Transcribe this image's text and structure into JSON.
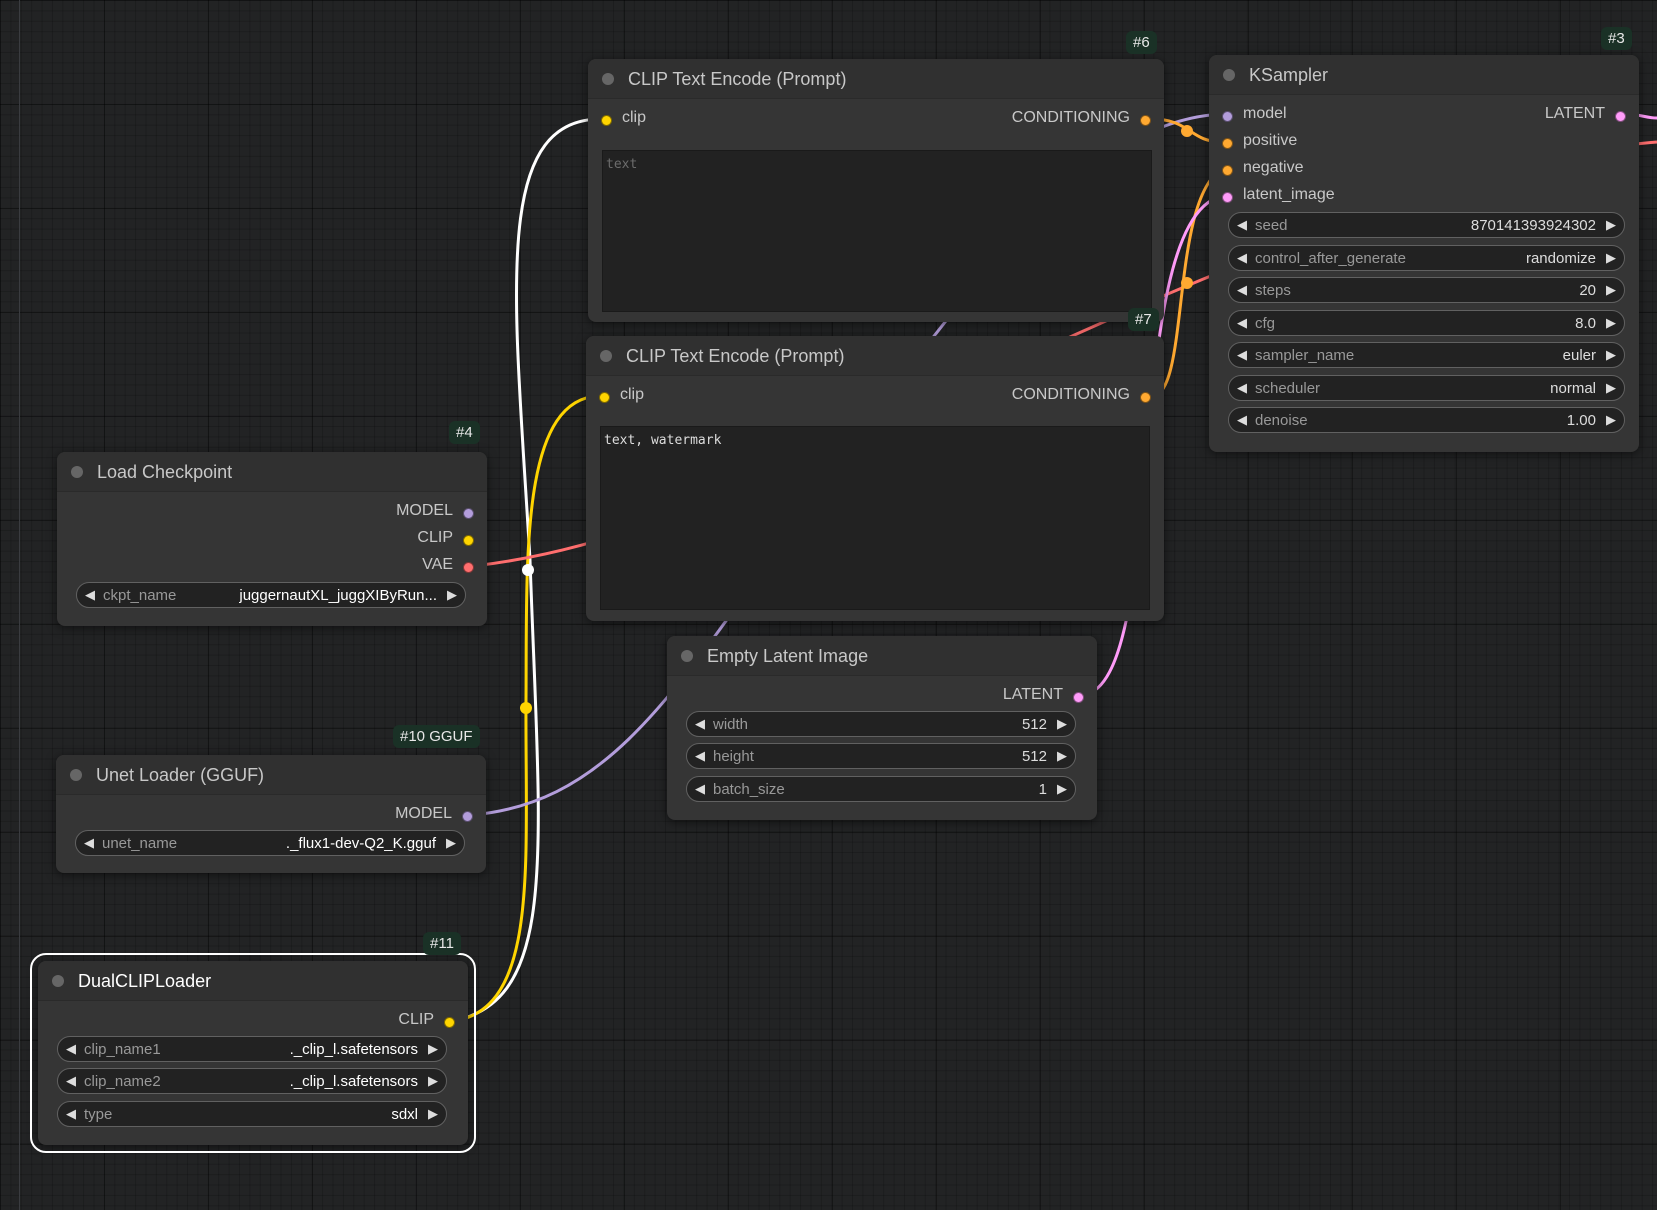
{
  "colors": {
    "clip": "#ffd500",
    "conditioning": "#ffa931",
    "model": "#b39ddb",
    "vae": "#ff6e6e",
    "latent": "#ff9cf9",
    "canvas": "#222324",
    "node_body": "#353535",
    "badge": "#1a3126"
  },
  "nodes": {
    "clip_text_pos": {
      "badge": "#6",
      "title": "CLIP Text Encode (Prompt)",
      "input_clip": "clip",
      "output_conditioning": "CONDITIONING",
      "text_placeholder": "text",
      "text_value": ""
    },
    "clip_text_neg": {
      "badge": "#7",
      "title": "CLIP Text Encode (Prompt)",
      "input_clip": "clip",
      "output_conditioning": "CONDITIONING",
      "text_value": "text, watermark"
    },
    "ksampler": {
      "badge": "#3",
      "title": "KSampler",
      "inputs": [
        "model",
        "positive",
        "negative",
        "latent_image"
      ],
      "output_latent": "LATENT",
      "widgets": [
        {
          "name": "seed",
          "value": "870141393924302"
        },
        {
          "name": "control_after_generate",
          "value": "randomize"
        },
        {
          "name": "steps",
          "value": "20"
        },
        {
          "name": "cfg",
          "value": "8.0"
        },
        {
          "name": "sampler_name",
          "value": "euler"
        },
        {
          "name": "scheduler",
          "value": "normal"
        },
        {
          "name": "denoise",
          "value": "1.00"
        }
      ]
    },
    "load_checkpoint": {
      "badge": "#4",
      "title": "Load Checkpoint",
      "outputs": [
        "MODEL",
        "CLIP",
        "VAE"
      ],
      "widget": {
        "name": "ckpt_name",
        "value": "juggernautXL_juggXIByRun..."
      }
    },
    "empty_latent": {
      "title": "Empty Latent Image",
      "output_latent": "LATENT",
      "widgets": [
        {
          "name": "width",
          "value": "512"
        },
        {
          "name": "height",
          "value": "512"
        },
        {
          "name": "batch_size",
          "value": "1"
        }
      ]
    },
    "unet_loader": {
      "badge": "#10 GGUF",
      "title": "Unet Loader (GGUF)",
      "output_model": "MODEL",
      "widget": {
        "name": "unet_name",
        "value": "._flux1-dev-Q2_K.gguf"
      }
    },
    "dual_clip": {
      "badge": "#11",
      "title": "DualCLIPLoader",
      "output_clip": "CLIP",
      "widgets": [
        {
          "name": "clip_name1",
          "value": "._clip_l.safetensors"
        },
        {
          "name": "clip_name2",
          "value": "._clip_l.safetensors"
        },
        {
          "name": "type",
          "value": "sdxl"
        }
      ]
    }
  }
}
